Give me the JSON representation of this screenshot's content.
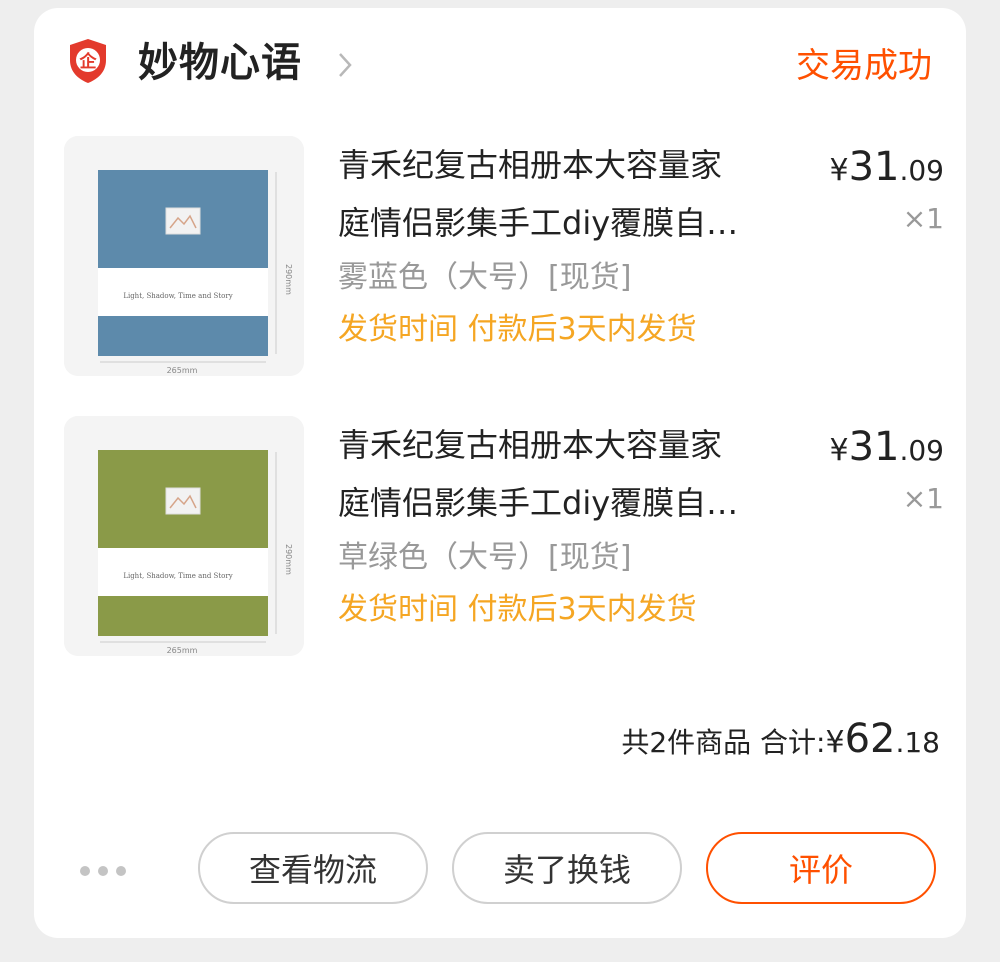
{
  "shop": {
    "name": "妙物心语",
    "status": "交易成功",
    "badge_glyph": "企"
  },
  "items": [
    {
      "title_line1": "青禾纪复古相册本大容量家",
      "title_line2": "庭情侣影集手工diy覆膜自…",
      "sku": "雾蓝色（大号）[现货]",
      "shipping": "发货时间 付款后3天内发货",
      "price_currency": "¥",
      "price_int": "31",
      "price_dec": ".09",
      "qty": "×1",
      "cover_color": "#5d8aab",
      "thumb_text": {
        "height": "290mm",
        "width": "265mm",
        "subtitle": "Light, Shadow, Time and Story"
      }
    },
    {
      "title_line1": "青禾纪复古相册本大容量家",
      "title_line2": "庭情侣影集手工diy覆膜自…",
      "sku": "草绿色（大号）[现货]",
      "shipping": "发货时间 付款后3天内发货",
      "price_currency": "¥",
      "price_int": "31",
      "price_dec": ".09",
      "qty": "×1",
      "cover_color": "#8a9a48",
      "thumb_text": {
        "height": "290mm",
        "width": "265mm",
        "subtitle": "Light, Shadow, Time and Story"
      }
    }
  ],
  "summary": {
    "count_label": "共2件商品 合计:",
    "currency": "¥",
    "total_int": "62",
    "total_dec": ".18"
  },
  "actions": {
    "logistics": "查看物流",
    "resell": "卖了换钱",
    "review": "评价"
  },
  "colors": {
    "accent": "#ff5000",
    "shipping_text": "#f5a623",
    "badge_red": "#e33a2c"
  }
}
